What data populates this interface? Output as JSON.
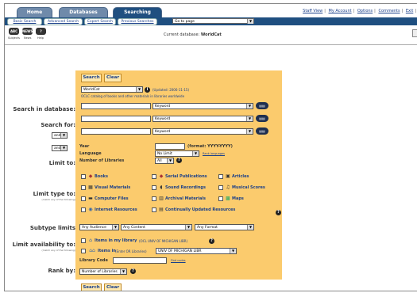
{
  "nav": {
    "tabs": [
      "Home",
      "Databases",
      "Searching"
    ],
    "active_tab": "Searching",
    "links": [
      "Staff View",
      "My Account",
      "Options",
      "Comments",
      "Exit"
    ],
    "sub_buttons": [
      "Basic Search",
      "Advanced Search",
      "Expert Search",
      "Previous Searches"
    ],
    "goto_page": "Go to page"
  },
  "iconbar": {
    "buttons": [
      {
        "icon": "subjects",
        "label": "Subjects"
      },
      {
        "icon": "news",
        "label": "News"
      },
      {
        "icon": "help",
        "label": "Help"
      }
    ],
    "current_db_label": "Current database:",
    "current_db": "WorldCat"
  },
  "form": {
    "search_label": "Search",
    "clear_label": "Clear",
    "search_in_label": "Search in database:",
    "database": "WorldCat",
    "updated": "(Updated: 2006-11-15)",
    "db_desc": "OCLC catalog of books and other materials in libraries worldwide",
    "search_for_label": "Search for:",
    "index_rows": [
      {
        "op": "",
        "index": "Keyword"
      },
      {
        "op": "and",
        "index": "Keyword"
      },
      {
        "op": "and",
        "index": "Keyword"
      }
    ],
    "limit_to_label": "Limit to:",
    "year_label": "Year",
    "year_format": "(format: YYYY-YYYY)",
    "language_label": "Language",
    "language_value": "No Limit",
    "rank_languages": "Rank languages",
    "num_libraries_label": "Number of Libraries",
    "num_libraries_value": "All",
    "limit_type_label": "Limit type to:",
    "limit_type_sub": "(match any of the following)",
    "types": [
      [
        "Books",
        "Serial Publications",
        "Articles"
      ],
      [
        "Visual Materials",
        "Sound Recordings",
        "Musical Scores"
      ],
      [
        "Computer Files",
        "Archival Materials",
        "Maps"
      ],
      [
        "Internet Resources",
        "Continually Updated Resources"
      ]
    ],
    "subtype_label": "Subtype limits",
    "subtypes": [
      "Any Audience",
      "Any Content",
      "Any Format"
    ],
    "limit_avail_label": "Limit availability to:",
    "limit_avail_sub": "(match any of the following)",
    "items_in_my_library": "Items in my library",
    "my_library_code": "(OCL UNIV OF MICHIGAN LIBR)",
    "items_in": "Items in",
    "other_libraries": "(Enter OR Libraries)",
    "library_select": "UNIV OF MICHIGAN LIBR",
    "library_code_label": "Library Code",
    "find_codes": "Find codes",
    "rank_by_label": "Rank by:",
    "rank_by_value": "Number of Libraries"
  },
  "colors": {
    "form_bg": "#fbcb6d",
    "nav_blue": "#1f4f80"
  }
}
